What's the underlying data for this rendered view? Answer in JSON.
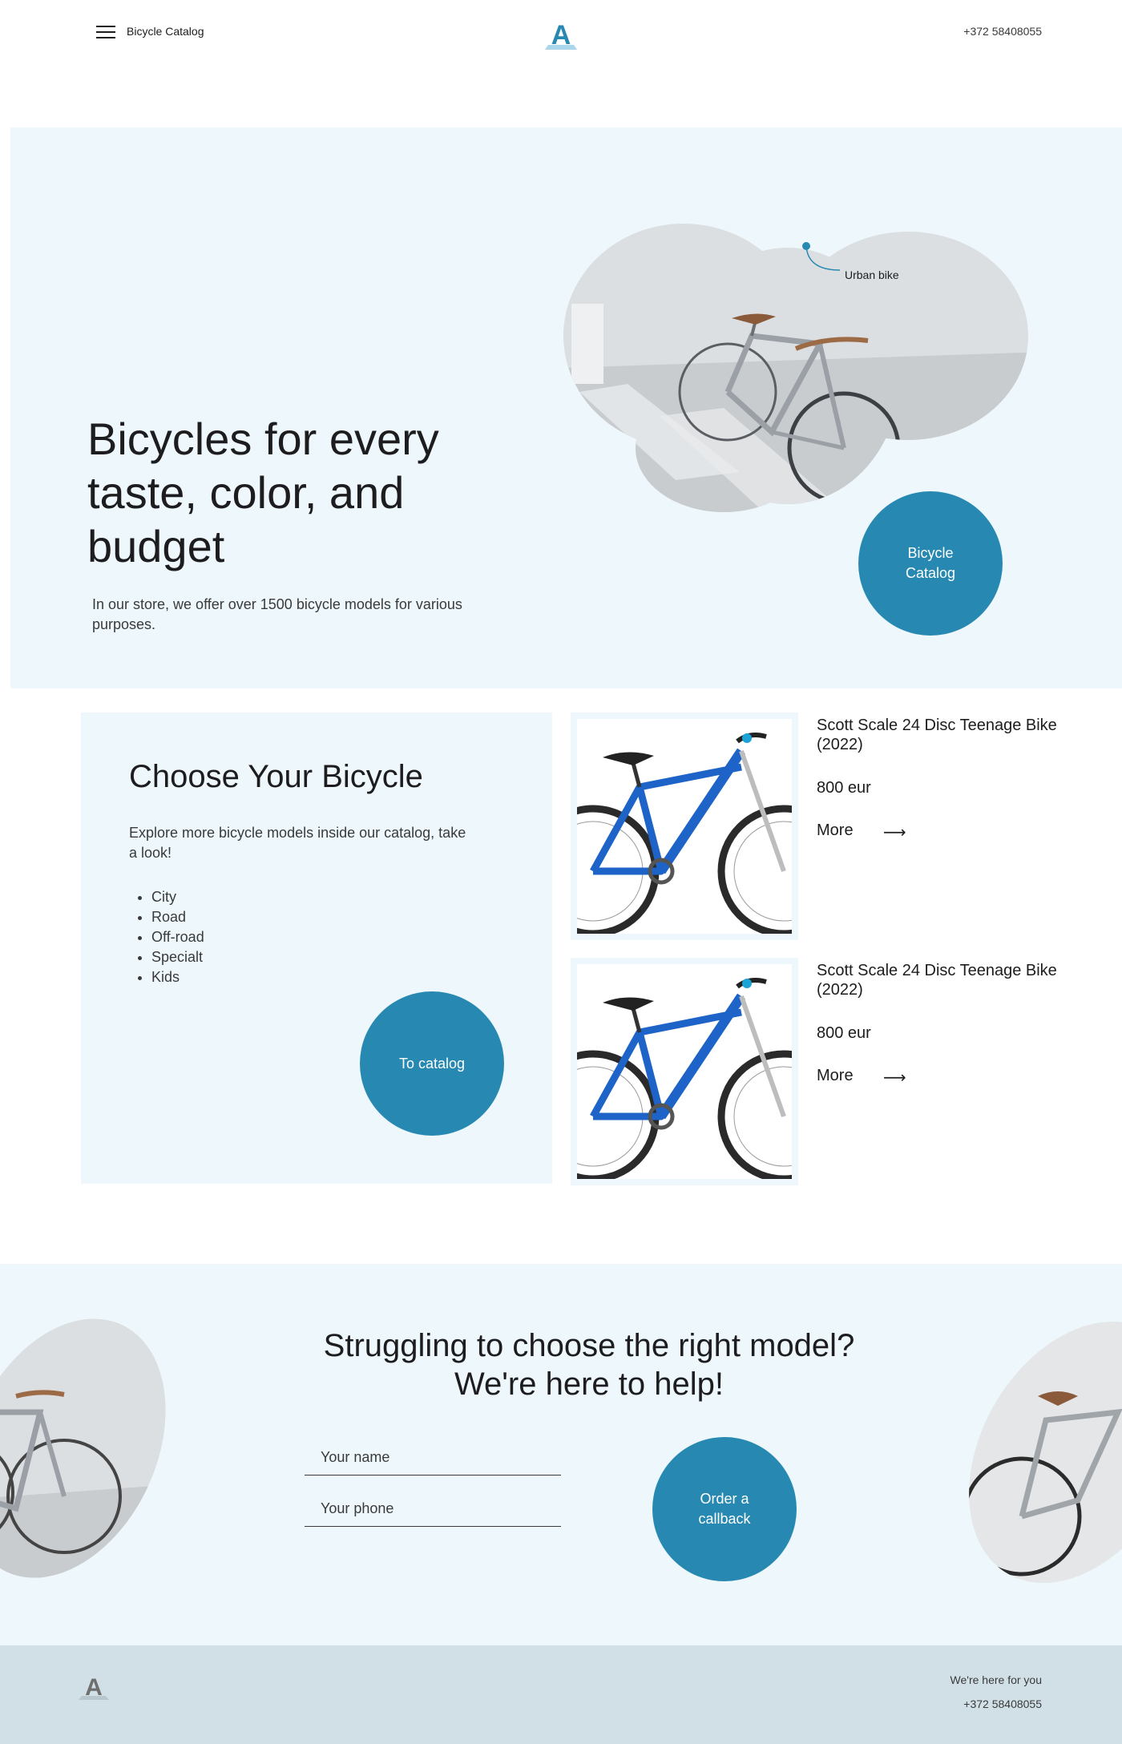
{
  "header": {
    "menu_icon": "hamburger-icon",
    "catalog_label": "Bicycle Catalog",
    "logo_text": "A",
    "phone": "+372 58408055"
  },
  "hero": {
    "title": "Bicycles for every taste, color, and budget",
    "subtitle": "In our store, we offer over 1500 bicycle models for various purposes.",
    "image_label": "Urban bike",
    "button_label": "Bicycle Catalog"
  },
  "choose": {
    "title": "Choose Your Bicycle",
    "text": "Explore more bicycle models inside our catalog, take a look!",
    "categories": [
      "City",
      "Road",
      "Off-road",
      "Specialt",
      "Kids"
    ],
    "button_label": "To catalog"
  },
  "products": [
    {
      "name": "Scott Scale 24 Disc Teenage Bike (2022)",
      "price": "800 eur",
      "more_label": "More",
      "arrow": "⟶"
    },
    {
      "name": "Scott Scale 24 Disc Teenage Bike (2022)",
      "price": "800 eur",
      "more_label": "More",
      "arrow": "⟶"
    }
  ],
  "help": {
    "title_line1": "Struggling to choose the right model?",
    "title_line2": "We're here to help!",
    "name_placeholder": "Your name",
    "phone_placeholder": "Your phone",
    "button_label": "Order a callback"
  },
  "footer": {
    "logo_text": "A",
    "tagline": "We're here for you",
    "phone": "+372 58408055"
  },
  "colors": {
    "accent": "#2789b2",
    "light_bg": "#eef8fc",
    "footer_bg": "#d1e0e7",
    "text": "#1d1d1f"
  }
}
